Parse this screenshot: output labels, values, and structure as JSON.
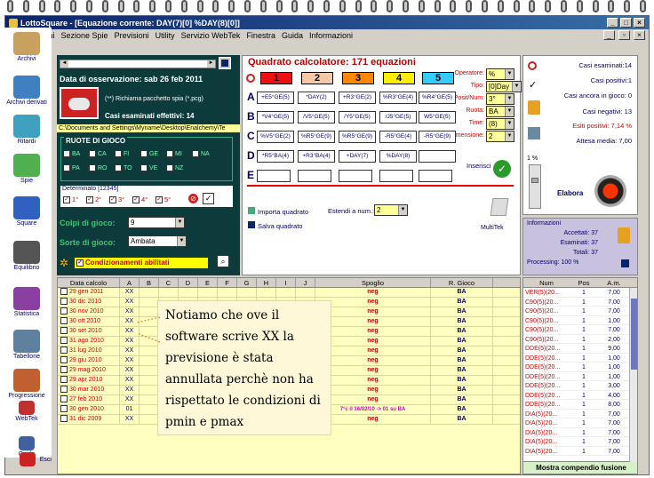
{
  "window": {
    "title": "LottoSquare - [Equazione corrente: DAY(7)[0] %DAY(8)[0]]"
  },
  "menu": [
    "Estrazioni",
    "Sezione Spie",
    "Previsioni",
    "Utility",
    "Servizio WebTek",
    "Finestra",
    "Guida",
    "Informazioni"
  ],
  "sidebar": [
    "Archivi",
    "Archivi derivati",
    "Ritardi",
    "Spie",
    "Square",
    "Equilibrio",
    "Statistica",
    "Tabellone",
    "Progressione",
    "WebTek",
    "Guida",
    "Esci"
  ],
  "left": {
    "obs_label": "Data di osservazione:",
    "obs_date": "sab 26 feb 2011",
    "spy_text": "(**) Richiama pacchetto spia (*.pcg)",
    "effective": "Casi esaminati effettivi: 14",
    "path": "C:\\Documents and Settings\\Myname\\Desktop\\Enalchemy\\Te",
    "ruote_title": "RUOTE DI GIOCO",
    "ruote": [
      "BA",
      "CA",
      "FI",
      "GE",
      "MI",
      "NA",
      "PA",
      "RO",
      "TO",
      "VE",
      "NZ"
    ],
    "determinato": "Determinato [12345]",
    "det_items": [
      "1°",
      "2°",
      "3°",
      "4°",
      "5°"
    ],
    "colpi_label": "Colpi di gioco:",
    "colpi_value": "9",
    "sorte_label": "Sorte di gioco:",
    "sorte_value": "Ambata",
    "cond_label": "Condizionamenti abilitati"
  },
  "calc": {
    "title": "Quadrato calcolatore: 171 equazioni",
    "cols": [
      "1",
      "2",
      "3",
      "4",
      "5"
    ],
    "col_colors": [
      "#ee1111",
      "#f5c9a8",
      "#ff8800",
      "#ffee00",
      "#33ccff"
    ],
    "rows": [
      {
        "label": "A",
        "cells": [
          "+E5°GE(5)",
          "*DAY(2)",
          "+R3°GE(2)",
          "%R3°GE(4)",
          "%R4°GE(5)"
        ]
      },
      {
        "label": "B",
        "cells": [
          "*V4°GE(5)",
          "/V5°GE(5)",
          "/Y5°GE(5)",
          "/J5°GE(5)",
          "W5°GE(5)"
        ]
      },
      {
        "label": "C",
        "cells": [
          "%V5°GE(2)",
          "%R5°GE(9)",
          "%R5°GE(9)",
          "-R5°GE(4)",
          "-R5°GE(9)"
        ]
      },
      {
        "label": "D",
        "cells": [
          "*R5°BA(4)",
          "+R3°BA(4)",
          "+DAY(7)",
          "%DAY(8)",
          ""
        ]
      },
      {
        "label": "E",
        "cells": [
          "",
          "",
          "",
          "",
          ""
        ]
      }
    ],
    "operatore_label": "Operatore:",
    "operatore": "%",
    "tipo_label": "Tipo:",
    "tipo": "[0]Day",
    "posnum_label": "Posit/Num:",
    "posnum": "3°",
    "ruota_label": "Ruota:",
    "ruota": "BA",
    "time_label": "Time:",
    "time": "(8)",
    "dim_label": "Dimensione:",
    "dim": "2",
    "inserisci": "Inserisci",
    "import": "Importa quadrato",
    "save": "Salva quadrato",
    "estendi_label": "Estendi a num.:",
    "estendi": "2",
    "multitek": "MultiTek"
  },
  "stats": {
    "esaminati": "Casi esaminati:14",
    "positivi": "Casi positivi:1",
    "ancora": "Casi ancora in gioco: 0",
    "negativi": "Casi negativi: 13",
    "esiti": "Esiti positivi: 7,14 %",
    "attesa": "Attesa media: 7,00",
    "percent": "1 %",
    "elabora": "Elabora"
  },
  "info": {
    "title": "Informazioni",
    "accettati": "Accettati: 37",
    "esaminati": "Esaminati: 37",
    "totali": "Totali: 37",
    "processing": "Processing: 100 %"
  },
  "table": {
    "headers": [
      "Data calcolo",
      "A",
      "B",
      "C",
      "D",
      "E",
      "F",
      "G",
      "H",
      "I",
      "J",
      "Spoglio",
      "R. Gioco"
    ],
    "rows": [
      [
        "29 gen 2011",
        "XX",
        "neg",
        "BA"
      ],
      [
        "30 dic 2010",
        "XX",
        "neg",
        "BA"
      ],
      [
        "30 nov 2010",
        "XX",
        "neg",
        "BA"
      ],
      [
        "30 ott 2010",
        "XX",
        "neg",
        "BA"
      ],
      [
        "30 set 2010",
        "XX",
        "neg",
        "BA"
      ],
      [
        "31 ago 2010",
        "XX",
        "neg",
        "BA"
      ],
      [
        "31 lug 2010",
        "XX",
        "neg",
        "BA"
      ],
      [
        "29 giu 2010",
        "XX",
        "neg",
        "BA"
      ],
      [
        "29 mag 2010",
        "XX",
        "neg",
        "BA"
      ],
      [
        "29 apr 2010",
        "XX",
        "neg",
        "BA"
      ],
      [
        "30 mar 2010",
        "XX",
        "neg",
        "BA"
      ],
      [
        "27 feb 2010",
        "XX",
        "neg",
        "BA"
      ],
      [
        "30 gen 2010",
        "01",
        "7°c il 16/02/10 -> 01 su BA",
        "BA"
      ],
      [
        "31 dic 2009",
        "XX",
        "neg",
        "BA"
      ]
    ]
  },
  "right_table": {
    "headers": [
      "Num",
      "Pos",
      "A.m."
    ],
    "rows": [
      [
        "VER(5)(20...",
        "1",
        "7,00"
      ],
      [
        "C90(5)(20...",
        "1",
        "7,00"
      ],
      [
        "C90(5)(20...",
        "1",
        "7,00"
      ],
      [
        "C90(5)(20...",
        "1",
        "1,00"
      ],
      [
        "C90(5)(20...",
        "1",
        "7,00"
      ],
      [
        "C90(5)(20...",
        "1",
        "2,00"
      ],
      [
        "DDE(5)(20...",
        "1",
        "9,00"
      ],
      [
        "DDE(5)(20...",
        "1",
        "1,00"
      ],
      [
        "DDE(5)(20...",
        "1",
        "1,00"
      ],
      [
        "DDE(5)(20...",
        "1",
        "1,00"
      ],
      [
        "DDE(5)(20...",
        "1",
        "3,00"
      ],
      [
        "DDE(5)(20...",
        "1",
        "4,00"
      ],
      [
        "DDE(5)(20...",
        "1",
        "8,00"
      ],
      [
        "DIA(5)(20...",
        "1",
        "7,00"
      ],
      [
        "DIA(5)(20...",
        "1",
        "7,00"
      ],
      [
        "DIA(5)(20...",
        "1",
        "7,00"
      ],
      [
        "DIA(5)(20...",
        "1",
        "7,00"
      ],
      [
        "DIA(5)(20...",
        "1",
        "7,00"
      ]
    ],
    "footer": "Mostra compendio fusione"
  },
  "note": "Notiamo che ove il software scrive XX la previsione è stata annullata perchè non ha rispettato le condizioni di pmin e pmax"
}
